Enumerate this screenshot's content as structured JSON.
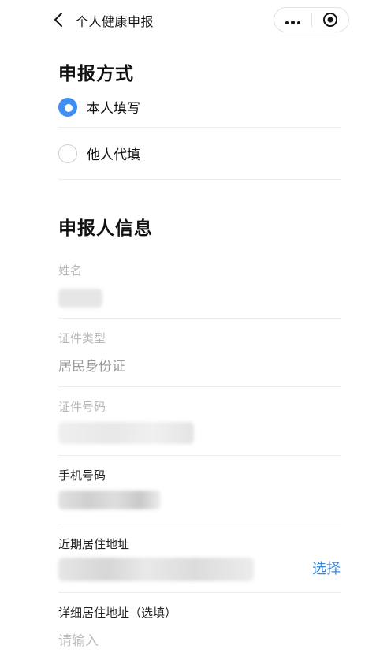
{
  "nav": {
    "title": "个人健康申报",
    "back_icon": "chevron-left-icon",
    "more_icon": "more-dots-icon",
    "close_icon": "target-close-icon"
  },
  "declaration_method": {
    "title": "申报方式",
    "options": [
      {
        "label": "本人填写",
        "checked": true
      },
      {
        "label": "他人代填",
        "checked": false
      }
    ]
  },
  "declarant_info": {
    "title": "申报人信息",
    "name": {
      "label": "姓名",
      "value_redacted": true
    },
    "id_type": {
      "label": "证件类型",
      "value": "居民身份证"
    },
    "id_number": {
      "label": "证件号码",
      "value_redacted": true
    },
    "phone": {
      "label": "手机号码",
      "value_redacted": true
    },
    "recent_address": {
      "label": "近期居住地址",
      "value_redacted": true,
      "action": "选择"
    },
    "detail_address": {
      "label": "详细居住地址（选填）",
      "placeholder": "请输入"
    }
  },
  "colors": {
    "accent": "#3f8ff2",
    "link": "#3a86d8",
    "divider": "#ececec",
    "muted_label": "#b8b8b8"
  }
}
